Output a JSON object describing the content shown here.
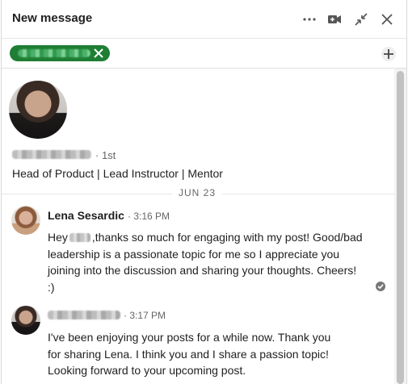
{
  "header": {
    "title": "New message",
    "icons": [
      "more-icon",
      "video-icon",
      "minimize-icon",
      "close-icon"
    ]
  },
  "recipients": {
    "pill_icon": "remove-icon",
    "add_icon": "plus-icon",
    "pill_color": "#1e7e34"
  },
  "profile": {
    "degree": "· 1st",
    "headline": "Head of Product | Lead Instructor | Mentor"
  },
  "conversation": {
    "date_label": "JUN 23",
    "messages": [
      {
        "sender": "Lena Sesardic",
        "time": "· 3:16 PM",
        "text_before": "Hey",
        "text_after": ",thanks so much for engaging with my post! Good/bad leadership is a passionate topic for me so I appreciate you joining into the discussion and sharing your thoughts. Cheers! :)",
        "status_icon": "seen-check-icon"
      },
      {
        "time": "· 3:17 PM",
        "text": "I've been enjoying your posts for a while now. Thank you for sharing Lena. I think you and I share a passion topic! Looking forward to your upcoming post."
      }
    ]
  }
}
